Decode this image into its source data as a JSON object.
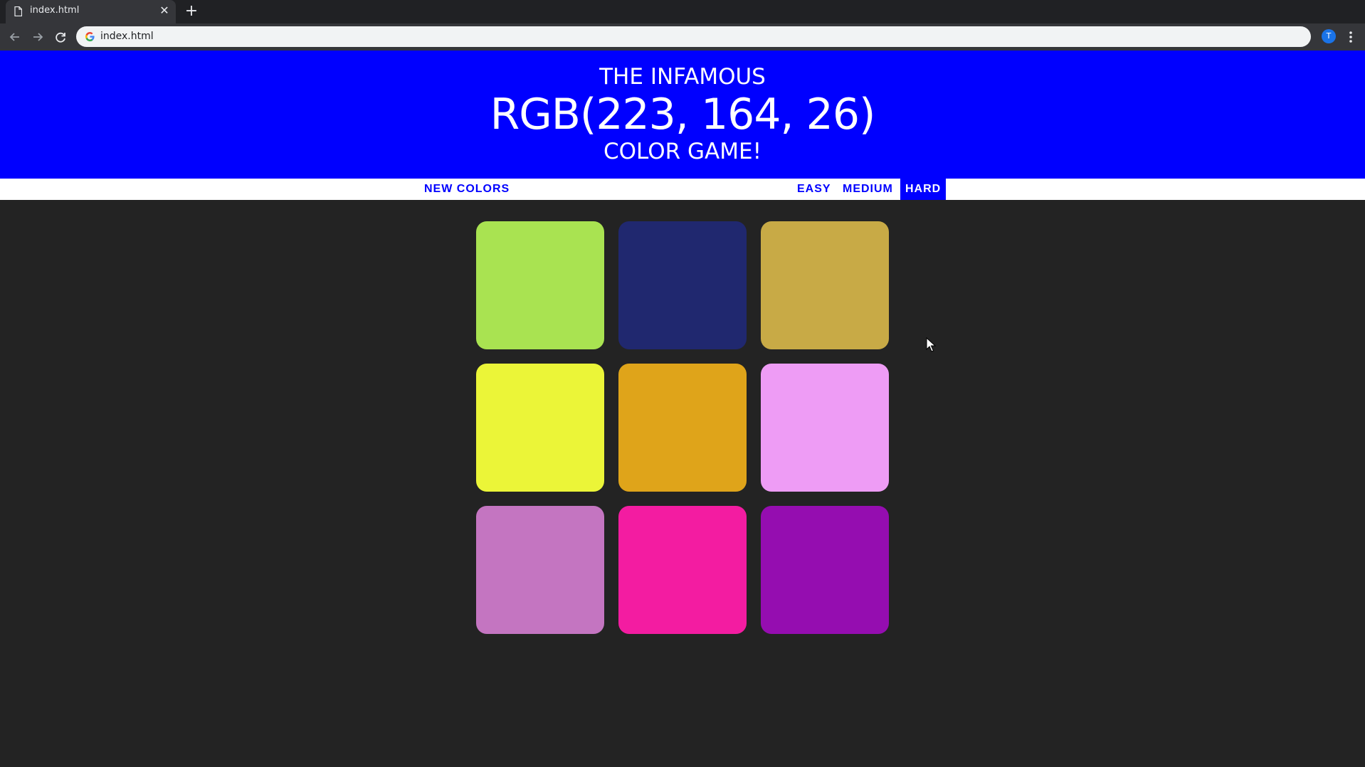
{
  "browser": {
    "tab_title": "index.html",
    "url": "index.html",
    "profile_initial": "T",
    "new_tab_symbol": "+",
    "close_symbol": "✕"
  },
  "game": {
    "header_color": "#0000ff",
    "title_top": "THE INFAMOUS",
    "rgb_target": "RGB(223, 164, 26)",
    "title_bottom": "COLOR GAME!",
    "new_colors_label": "NEW COLORS",
    "modes": [
      {
        "label": "EASY",
        "selected": false
      },
      {
        "label": "MEDIUM",
        "selected": false
      },
      {
        "label": "HARD",
        "selected": true
      }
    ],
    "squares": [
      "#a9e351",
      "#20286f",
      "#c8aa46",
      "#ebf538",
      "#dfa41a",
      "#ee9cf5",
      "#c475c1",
      "#f31ca1",
      "#950db0"
    ]
  }
}
